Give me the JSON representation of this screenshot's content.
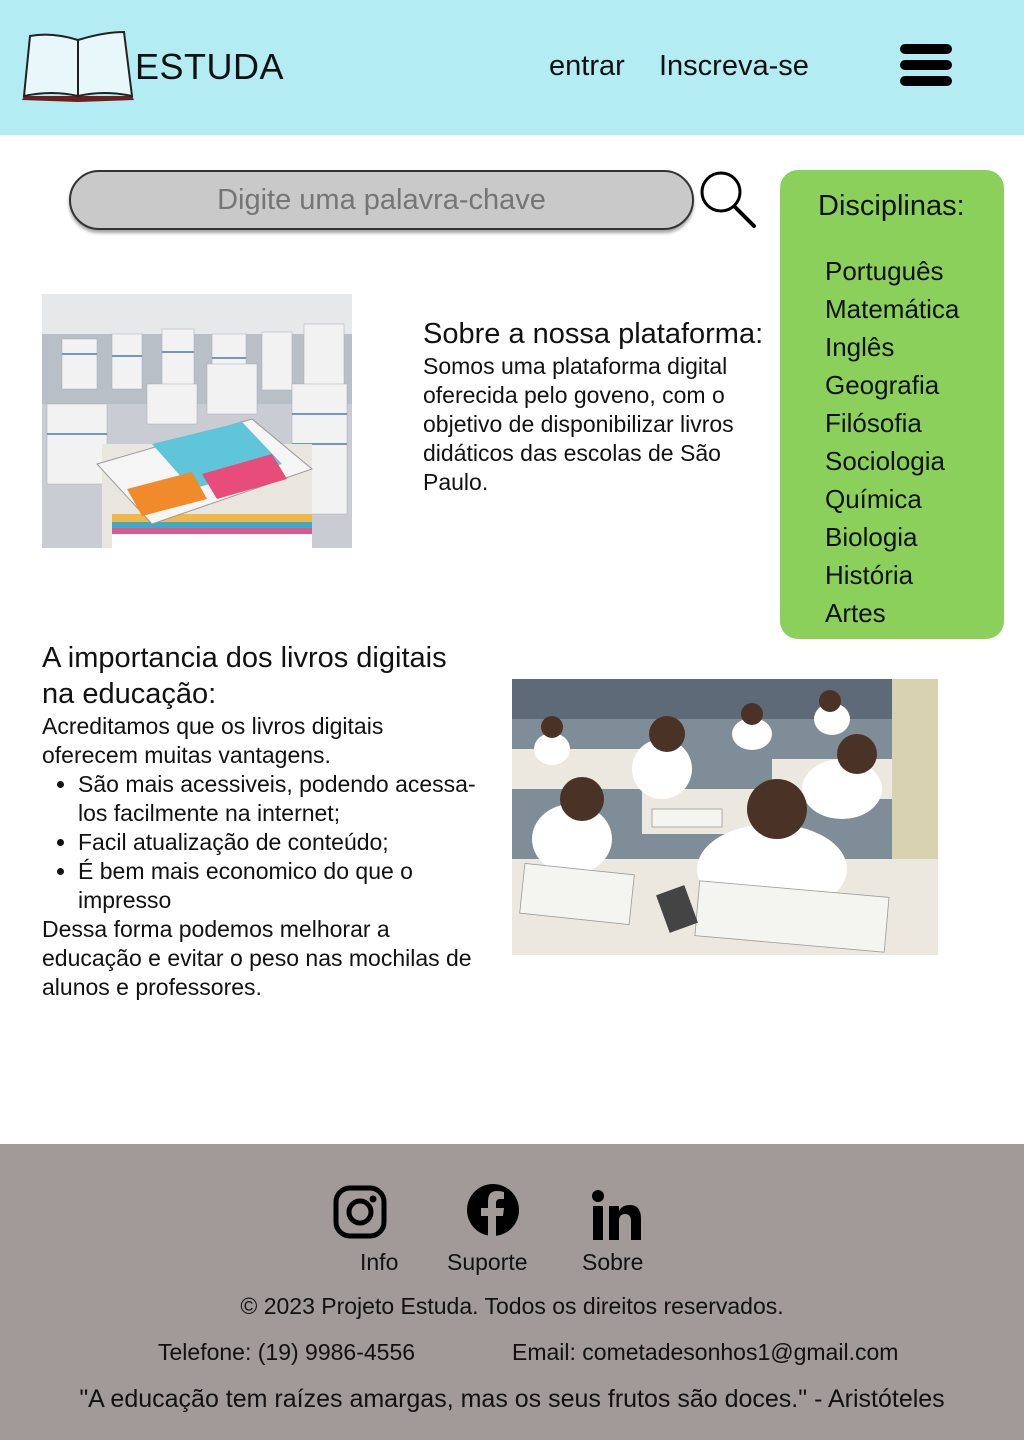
{
  "header": {
    "brand": "ESTUDA",
    "logo_icon": "open-book-icon",
    "login_label": "entrar",
    "signup_label": "Inscreva-se",
    "menu_icon": "hamburger-menu-icon",
    "background": "#b3ecf3"
  },
  "search": {
    "placeholder": "Digite uma palavra-chave",
    "icon": "magnifier-icon"
  },
  "disciplines": {
    "title": "Disciplinas:",
    "background": "#8bd05a",
    "items": [
      "Português",
      "Matemática",
      "Inglês",
      "Geografia",
      "Filósofia",
      "Sociologia",
      "Química",
      "Biologia",
      "História",
      "Artes"
    ]
  },
  "about": {
    "title": "Sobre a nossa plataforma:",
    "body": "Somos uma plataforma digital oferecida pelo goveno, com o objetivo de disponibilizar livros didáticos das escolas de São Paulo."
  },
  "importance": {
    "title": "A importancia dos livros digitais na educação:",
    "intro": "Acreditamos que os livros digitais oferecem muitas vantagens.",
    "bullets": [
      "São mais acessiveis, podendo acessa-los facilmente na internet;",
      "Facil atualização de conteúdo;",
      "É bem mais economico do que o impresso"
    ],
    "outro": "Dessa forma podemos melhorar a educação e evitar o peso nas mochilas de alunos e professores."
  },
  "footer": {
    "background": "#a29999",
    "links": [
      "Info",
      "Suporte",
      "Sobre"
    ],
    "social_icons": [
      "instagram-icon",
      "facebook-icon",
      "linkedin-icon"
    ],
    "copyright": "© 2023 Projeto Estuda. Todos os direitos reservados.",
    "phone": "Telefone: (19) 9986-4556",
    "email": "Email: cometadesonhos1@gmail.com",
    "quote": "\"A educação tem raízes amargas, mas os seus frutos são doces.\" - Aristóteles"
  }
}
